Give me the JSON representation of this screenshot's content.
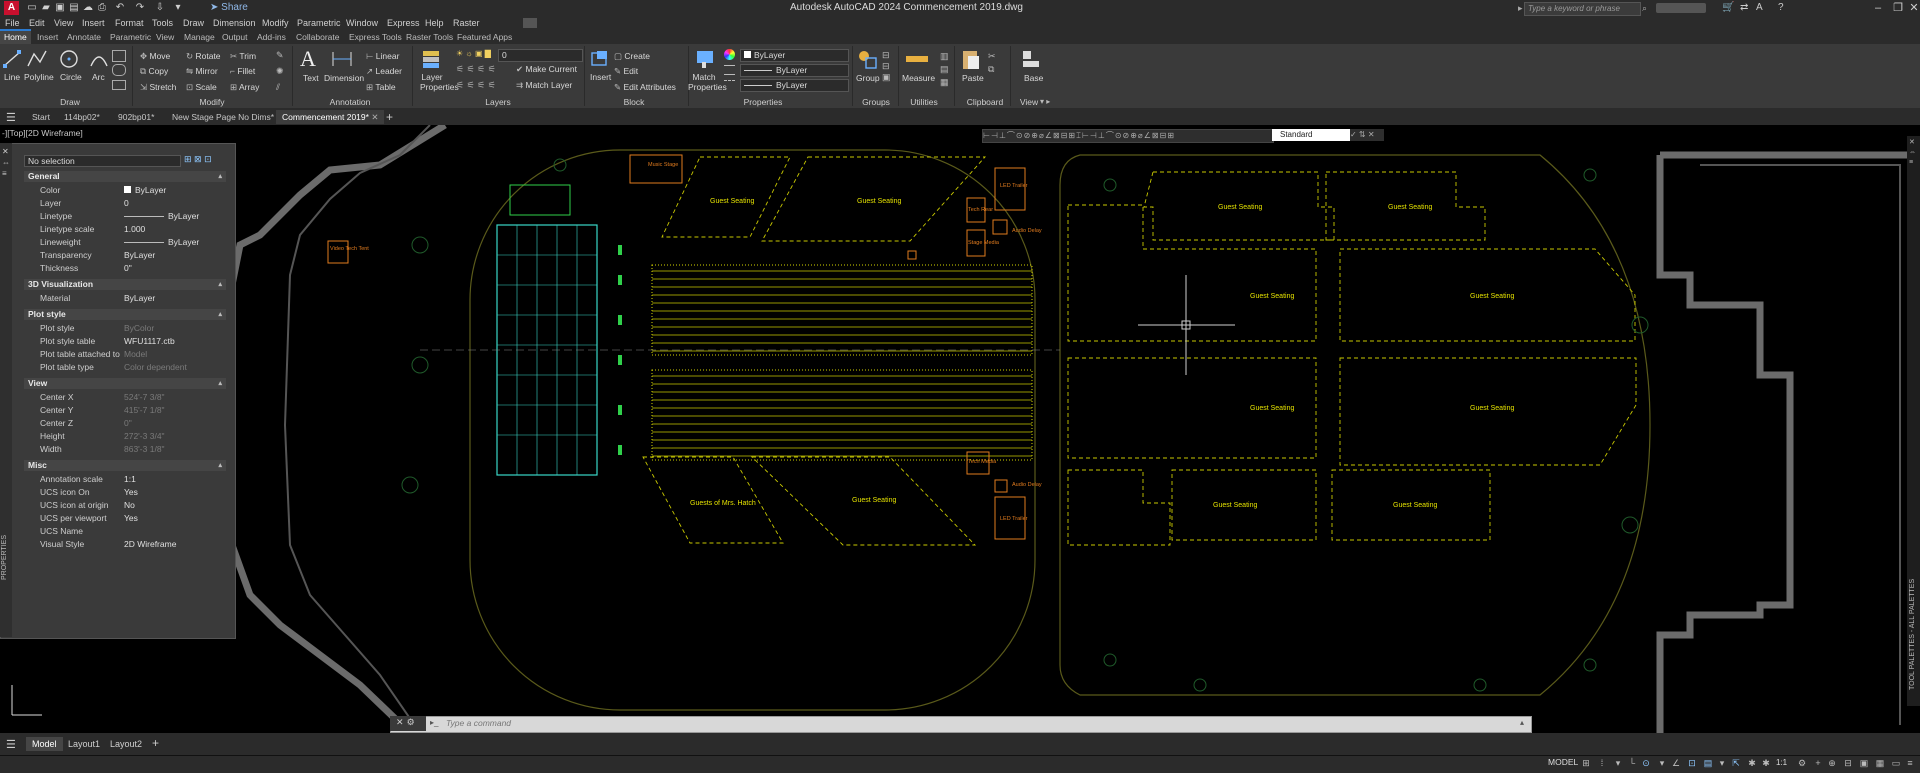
{
  "app": {
    "logo_letter": "A",
    "window_title": "Autodesk AutoCAD 2024   Commencement 2019.dwg",
    "share_label": "Share",
    "search_placeholder": "Type a keyword or phrase"
  },
  "menubar": [
    "File",
    "Edit",
    "View",
    "Insert",
    "Format",
    "Tools",
    "Draw",
    "Dimension",
    "Modify",
    "Parametric",
    "Window",
    "Express",
    "Help",
    "Raster"
  ],
  "ribbon_tabs": [
    "Home",
    "Insert",
    "Annotate",
    "Parametric",
    "View",
    "Manage",
    "Output",
    "Add-ins",
    "Collaborate",
    "Express Tools",
    "Raster Tools",
    "Featured Apps"
  ],
  "ribbon": {
    "draw": {
      "line": "Line",
      "polyline": "Polyline",
      "circle": "Circle",
      "arc": "Arc",
      "panel": "Draw"
    },
    "modify": {
      "move": "Move",
      "rotate": "Rotate",
      "trim": "Trim",
      "copy": "Copy",
      "mirror": "Mirror",
      "fillet": "Fillet",
      "stretch": "Stretch",
      "scale": "Scale",
      "array": "Array",
      "panel": "Modify"
    },
    "annotation": {
      "text": "Text",
      "dimension": "Dimension",
      "linear": "Linear",
      "leader": "Leader",
      "table": "Table",
      "panel": "Annotation"
    },
    "layers": {
      "layer_properties": "Layer Properties",
      "layer_value": "0",
      "make_current": "Make Current",
      "match_layer": "Match Layer",
      "panel": "Layers"
    },
    "block": {
      "insert": "Insert",
      "create": "Create",
      "edit": "Edit",
      "edit_attributes": "Edit Attributes",
      "panel": "Block"
    },
    "properties": {
      "match": "Match Properties",
      "color": "ByLayer",
      "linetype": "ByLayer",
      "lineweight": "ByLayer",
      "panel": "Properties"
    },
    "groups": {
      "group": "Group",
      "panel": "Groups"
    },
    "utilities": {
      "measure": "Measure",
      "panel": "Utilities"
    },
    "clipboard": {
      "paste": "Paste",
      "panel": "Clipboard"
    },
    "view": {
      "base": "Base",
      "panel": "View"
    }
  },
  "file_tabs": [
    "Start",
    "114bp02*",
    "902bp01*",
    "New Stage Page No Dims*",
    "Commencement 2019*"
  ],
  "viewport_label": "-][Top][2D Wireframe]",
  "text_style": "Standard",
  "properties_palette": {
    "selection": "No selection",
    "groups": [
      {
        "name": "General",
        "rows": [
          {
            "key": "Color",
            "value": "ByLayer"
          },
          {
            "key": "Layer",
            "value": "0"
          },
          {
            "key": "Linetype",
            "value": "ByLayer"
          },
          {
            "key": "Linetype scale",
            "value": "1.000"
          },
          {
            "key": "Lineweight",
            "value": "ByLayer"
          },
          {
            "key": "Transparency",
            "value": "ByLayer"
          },
          {
            "key": "Thickness",
            "value": "0\""
          }
        ]
      },
      {
        "name": "3D Visualization",
        "rows": [
          {
            "key": "Material",
            "value": "ByLayer"
          }
        ]
      },
      {
        "name": "Plot style",
        "rows": [
          {
            "key": "Plot style",
            "value": "ByColor",
            "dim": true
          },
          {
            "key": "Plot style table",
            "value": "WFU1117.ctb"
          },
          {
            "key": "Plot table attached to",
            "value": "Model",
            "dim": true
          },
          {
            "key": "Plot table type",
            "value": "Color dependent",
            "dim": true
          }
        ]
      },
      {
        "name": "View",
        "rows": [
          {
            "key": "Center X",
            "value": "524'-7 3/8\"",
            "dim": true
          },
          {
            "key": "Center Y",
            "value": "415'-7 1/8\"",
            "dim": true
          },
          {
            "key": "Center Z",
            "value": "0\"",
            "dim": true
          },
          {
            "key": "Height",
            "value": "272'-3 3/4\"",
            "dim": true
          },
          {
            "key": "Width",
            "value": "863'-3 1/8\"",
            "dim": true
          }
        ]
      },
      {
        "name": "Misc",
        "rows": [
          {
            "key": "Annotation scale",
            "value": "1:1"
          },
          {
            "key": "UCS icon On",
            "value": "Yes"
          },
          {
            "key": "UCS icon at origin",
            "value": "No"
          },
          {
            "key": "UCS per viewport",
            "value": "Yes"
          },
          {
            "key": "UCS Name",
            "value": ""
          },
          {
            "key": "Visual Style",
            "value": "2D Wireframe"
          }
        ]
      }
    ],
    "side_label": "PROPERTIES"
  },
  "drawing_labels": {
    "music_stage": "Music Stage",
    "video_tech_tent": "Video Tech Tent",
    "guest_seating": "Guest Seating",
    "guests_of_mrs_hatch": "Guests of Mrs. Hatch",
    "led_trailer": "LED Trailer",
    "tech_rear": "Tech Rear",
    "stage_media": "Stage Media",
    "audio_delay": "Audio Delay",
    "tech_media": "Tech Media"
  },
  "right_palette_label": "TOOL PALETTES - ALL PALETTES",
  "command_placeholder": "Type a command",
  "layout_tabs": [
    "Model",
    "Layout1",
    "Layout2"
  ],
  "status": {
    "mode": "MODEL",
    "scale": "1:1"
  }
}
